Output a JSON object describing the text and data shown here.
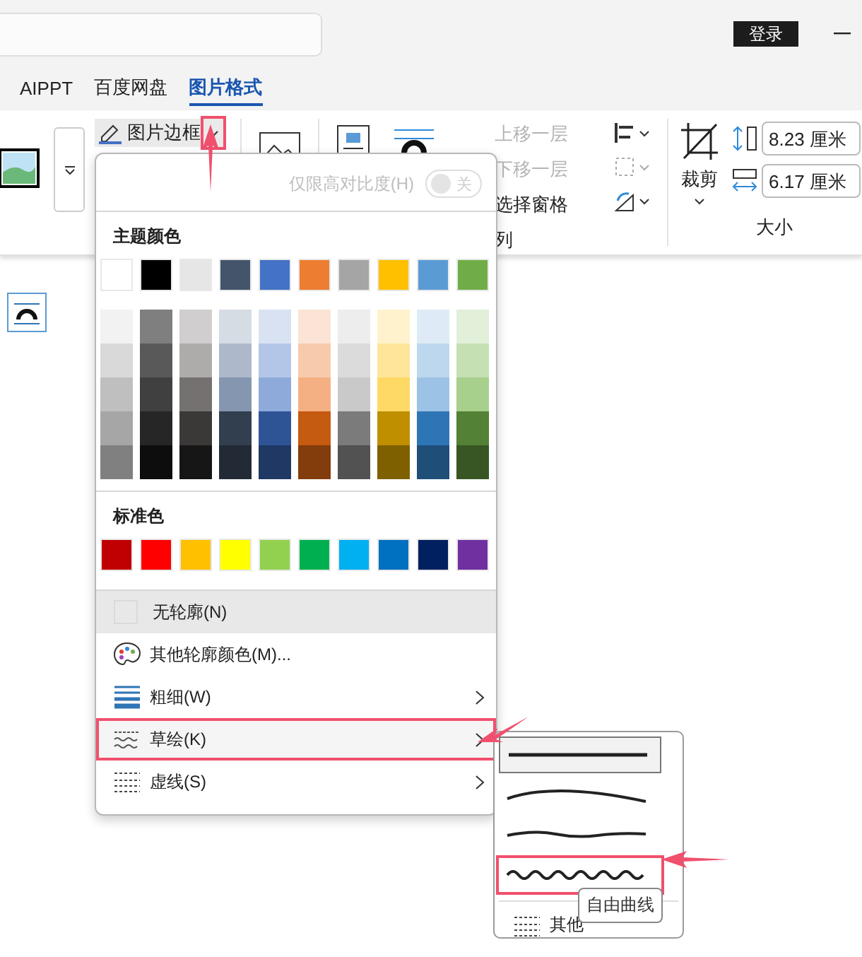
{
  "title_bar": {
    "login_button": "登录"
  },
  "tabs": [
    {
      "label": "AIPPT",
      "selected": false
    },
    {
      "label": "百度网盘",
      "selected": false
    },
    {
      "label": "图片格式",
      "selected": true
    }
  ],
  "ribbon": {
    "picture_border_button": "图片边框",
    "arrange": [
      {
        "label": "上移一层",
        "disabled": true
      },
      {
        "label": "下移一层",
        "disabled": true
      },
      {
        "label": "选择窗格",
        "disabled": false
      }
    ],
    "arrange_group_label": "列",
    "crop_button": "裁剪",
    "height_field": "8.23 厘米",
    "width_field": "6.17 厘米",
    "size_group_label": "大小"
  },
  "border_menu": {
    "high_contrast": {
      "label": "仅限高对比度(H)",
      "toggle": "关",
      "on": false,
      "disabled": true
    },
    "theme_colors_title": "主题颜色",
    "theme_colors": [
      {
        "color": "#ffffff",
        "shades": [
          {
            "color": "#f2f2f2"
          },
          {
            "color": "#d9d9d9"
          },
          {
            "color": "#bfbfbf"
          },
          {
            "color": "#a6a6a6"
          },
          {
            "color": "#808080"
          }
        ]
      },
      {
        "color": "#000000",
        "shades": [
          {
            "color": "#7f7f7f"
          },
          {
            "color": "#595959"
          },
          {
            "color": "#404040"
          },
          {
            "color": "#262626"
          },
          {
            "color": "#0d0d0d"
          }
        ]
      },
      {
        "color": "#e7e6e6",
        "shades": [
          {
            "color": "#d0cece"
          },
          {
            "color": "#aeabab"
          },
          {
            "color": "#757171"
          },
          {
            "color": "#3b3838"
          },
          {
            "color": "#171616"
          }
        ]
      },
      {
        "color": "#44546a",
        "shades": [
          {
            "color": "#d6dce4"
          },
          {
            "color": "#adb9ca"
          },
          {
            "color": "#8496b0"
          },
          {
            "color": "#323f4f"
          },
          {
            "color": "#222a35"
          }
        ]
      },
      {
        "color": "#4472c4",
        "shades": [
          {
            "color": "#d9e2f3"
          },
          {
            "color": "#b4c6e7"
          },
          {
            "color": "#8eaadb"
          },
          {
            "color": "#2f5496"
          },
          {
            "color": "#1f3864"
          }
        ]
      },
      {
        "color": "#ed7d31",
        "shades": [
          {
            "color": "#fbe4d5"
          },
          {
            "color": "#f7caac"
          },
          {
            "color": "#f4b083"
          },
          {
            "color": "#c55a11"
          },
          {
            "color": "#833c0b"
          }
        ]
      },
      {
        "color": "#a5a5a5",
        "shades": [
          {
            "color": "#ededed"
          },
          {
            "color": "#dbdbdb"
          },
          {
            "color": "#c9c9c9"
          },
          {
            "color": "#7b7b7b"
          },
          {
            "color": "#525252"
          }
        ]
      },
      {
        "color": "#ffc000",
        "shades": [
          {
            "color": "#fff2cc"
          },
          {
            "color": "#fee599"
          },
          {
            "color": "#ffd965"
          },
          {
            "color": "#bf8f00"
          },
          {
            "color": "#7f6000"
          }
        ]
      },
      {
        "color": "#5b9bd5",
        "shades": [
          {
            "color": "#deebf6"
          },
          {
            "color": "#bdd7ee"
          },
          {
            "color": "#9cc3e5"
          },
          {
            "color": "#2e75b5"
          },
          {
            "color": "#1f4e79"
          }
        ]
      },
      {
        "color": "#70ad47",
        "shades": [
          {
            "color": "#e2efd9"
          },
          {
            "color": "#c5e0b3"
          },
          {
            "color": "#a8d08d"
          },
          {
            "color": "#538135"
          },
          {
            "color": "#375623"
          }
        ]
      }
    ],
    "standard_colors_title": "标准色",
    "standard_colors": [
      {
        "color": "#c00000"
      },
      {
        "color": "#ff0000"
      },
      {
        "color": "#ffc000"
      },
      {
        "color": "#ffff00"
      },
      {
        "color": "#92d050"
      },
      {
        "color": "#00b050"
      },
      {
        "color": "#00b0f0"
      },
      {
        "color": "#0070c0"
      },
      {
        "color": "#002060"
      },
      {
        "color": "#7030a0"
      }
    ],
    "items": [
      {
        "kind": "none",
        "label": "无轮廓(N)",
        "hovered": true,
        "submenu": false,
        "annotated": false
      },
      {
        "kind": "palette",
        "label": "其他轮廓颜色(M)...",
        "hovered": false,
        "submenu": false,
        "annotated": false
      },
      {
        "kind": "weight",
        "label": "粗细(W)",
        "hovered": false,
        "submenu": true,
        "annotated": false
      },
      {
        "kind": "sketch",
        "label": "草绘(K)",
        "hovered": false,
        "submenu": true,
        "annotated": true
      },
      {
        "kind": "dash",
        "label": "虚线(S)",
        "hovered": false,
        "submenu": true,
        "annotated": false
      }
    ]
  },
  "sketch_submenu": {
    "styles": [
      {
        "kind": "straight",
        "selected": true,
        "annotated": false
      },
      {
        "kind": "curved",
        "selected": false,
        "annotated": false
      },
      {
        "kind": "scribble",
        "selected": false,
        "annotated": false
      },
      {
        "kind": "freehand",
        "selected": false,
        "annotated": true
      }
    ],
    "more_item": "其他",
    "tooltip": "自由曲线"
  }
}
